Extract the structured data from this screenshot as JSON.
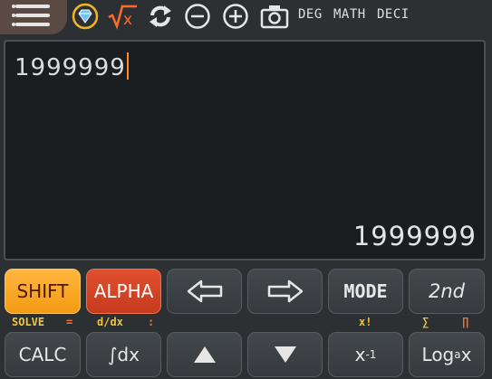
{
  "toolbar": {
    "angle_mode": "DEG",
    "input_mode": "MATH",
    "output_mode": "DECI",
    "icons": [
      "menu-icon",
      "gem-icon",
      "sqrt-x-icon",
      "refresh-icon",
      "zoom-out-icon",
      "zoom-in-icon",
      "camera-icon"
    ],
    "sqrt_label": "x"
  },
  "display": {
    "input": "1999999",
    "result": "1999999"
  },
  "keys_row1": {
    "shift": "SHIFT",
    "alpha": "ALPHA",
    "mode": "MODE",
    "second": "2nd"
  },
  "sublabels": {
    "solve": "SOLVE",
    "equals": "=",
    "ddx": "d/dx",
    "colon": ":",
    "factorial": "x!",
    "sum": "∑",
    "product": "∏"
  },
  "keys_row2": {
    "calc": "CALC",
    "integral": "∫dx",
    "inverse_base": "x",
    "inverse_exp": "-1",
    "log_base": "Log",
    "log_sub": "a",
    "log_arg": "x"
  },
  "colors": {
    "shift": "#f59a12",
    "alpha": "#c63a1e",
    "accent_orange": "#ff6b2a",
    "accent_yellow": "#f3c53b",
    "caret": "#ff8a2b"
  }
}
